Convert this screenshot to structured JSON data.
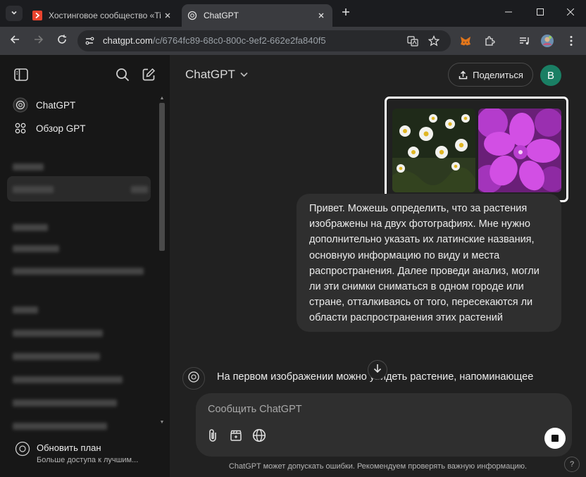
{
  "browser": {
    "tabs": [
      {
        "title": "Хостинговое сообщество «Tim",
        "active": false
      },
      {
        "title": "ChatGPT",
        "active": true
      }
    ],
    "url_host": "chatgpt.com",
    "url_path": "/c/6764fc89-68c0-800c-9ef2-662e2fa840f5"
  },
  "sidebar": {
    "items": [
      {
        "label": "ChatGPT",
        "icon": "openai-logo-icon"
      },
      {
        "label": "Обзор GPT",
        "icon": "grid-icon"
      }
    ],
    "upgrade": {
      "title": "Обновить план",
      "subtitle": "Больше доступа к лучшим..."
    }
  },
  "header": {
    "model_name": "ChatGPT",
    "share_label": "Поделиться",
    "avatar_letter": "B",
    "avatar_color": "#1a7f64"
  },
  "conversation": {
    "user_message_lines": [
      "Привет. Можешь определить, что за растения",
      "изображены на двух фотографиях. Мне нужно",
      "дополнительно указать их латинские названия,",
      "основную информацию по виду и места",
      "распространения. Далее проведи анализ, могли",
      "ли эти снимки сниматься в одном городе или",
      "стране, отталкиваясь от того, пересекаются ли",
      "области распространения этих растений"
    ],
    "assistant_partial": "На первом изображении можно увидеть растение, напоминающее"
  },
  "composer": {
    "placeholder": "Сообщить ChatGPT"
  },
  "footer": {
    "disclaimer": "ChatGPT может допускать ошибки. Рекомендуем проверять важную информацию.",
    "help": "?"
  }
}
